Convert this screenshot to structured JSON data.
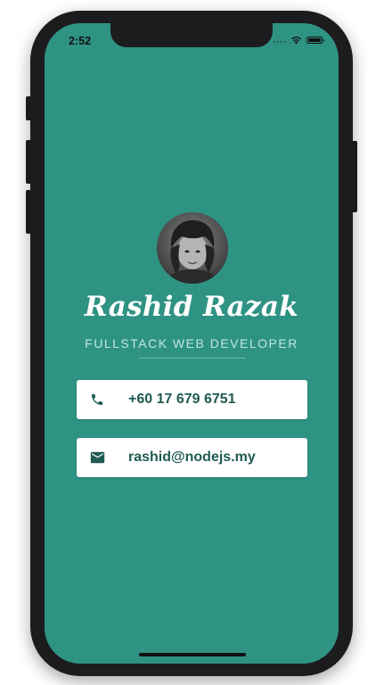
{
  "status_bar": {
    "time": "2:52",
    "battery_level": 1.0
  },
  "profile": {
    "name": "Rashid Razak",
    "title": "FULLSTACK WEB DEVELOPER"
  },
  "contacts": {
    "phone": "+60 17 679 6751",
    "email": "rashid@nodejs.my"
  },
  "colors": {
    "background": "#2f9384",
    "card": "#ffffff",
    "card_text": "#1f5a52",
    "title_text": "#bfe7e0"
  },
  "icons": {
    "phone": "phone-icon",
    "email": "email-icon",
    "wifi": "wifi-icon",
    "battery": "battery-icon"
  }
}
